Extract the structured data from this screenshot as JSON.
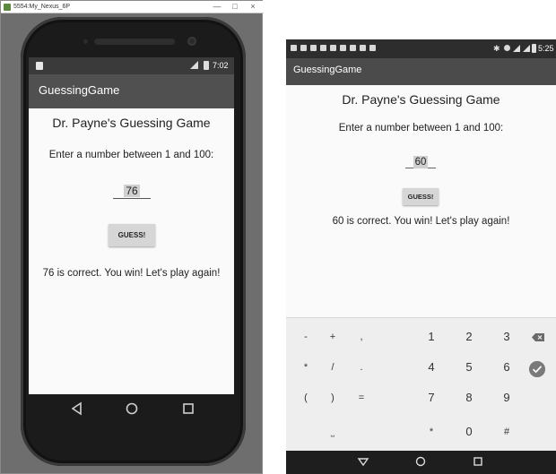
{
  "emulator": {
    "window_title": "5554:My_Nexus_6P",
    "controls": {
      "minimize": "—",
      "maximize": "□",
      "close": "×"
    },
    "status_time": "7:02",
    "app_title": "GuessingGame",
    "heading": "Dr. Payne's Guessing Game",
    "prompt": "Enter a number between 1 and 100:",
    "input_value": "76",
    "button_label": "GUESS!",
    "result": "76 is correct. You win! Let's play again!"
  },
  "device": {
    "status_time": "5:25",
    "app_title": "GuessingGame",
    "heading": "Dr. Payne's Guessing Game",
    "prompt": "Enter a number between 1 and 100:",
    "input_value": "60",
    "button_label": "GUESS!",
    "result": "60 is correct. You win! Let's play again!",
    "keyboard": {
      "row1": [
        "-",
        "+",
        ",",
        "1",
        "2",
        "3"
      ],
      "row2": [
        "*",
        "/",
        ".",
        "4",
        "5",
        "6"
      ],
      "row3": [
        "(",
        ")",
        "=",
        "7",
        "8",
        "9"
      ],
      "row4": [
        "⎵",
        "*",
        "0",
        "#"
      ]
    }
  },
  "colors": {
    "app_bar": "#505050",
    "status_bar": "#2d2d2d",
    "button": "#d6d6d6",
    "keyboard_bg": "#eeeeee"
  }
}
